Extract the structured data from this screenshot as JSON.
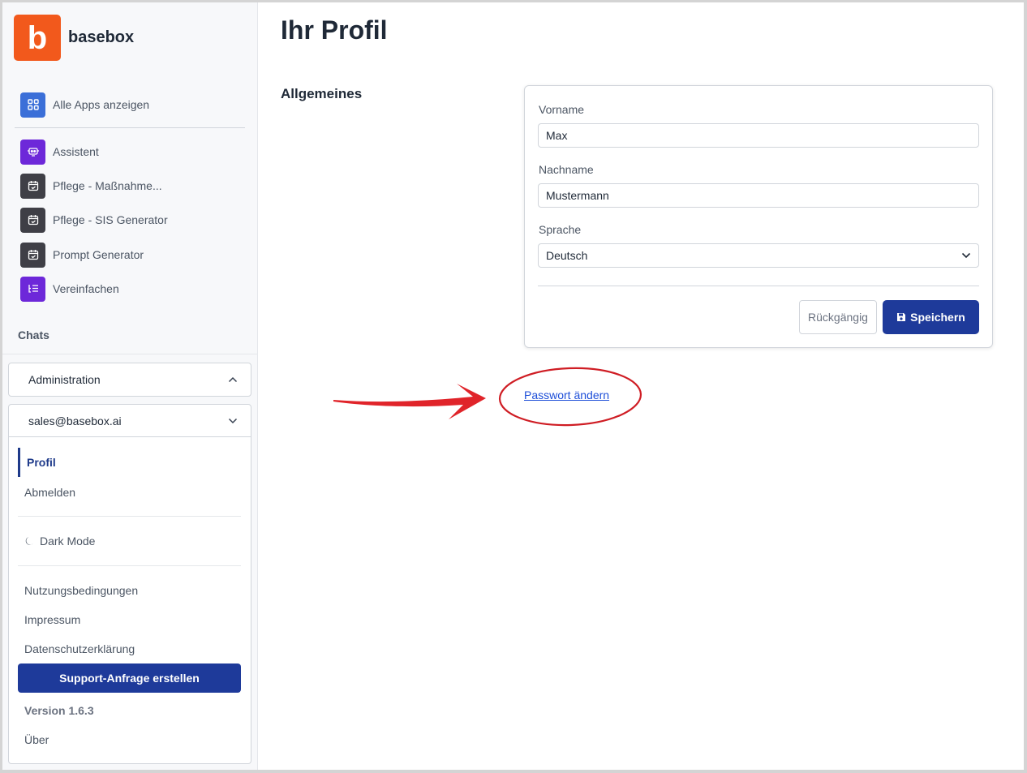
{
  "brand": {
    "name": "basebox",
    "logo_letter": "b",
    "logo_color": "#f2591c"
  },
  "sidebar": {
    "all_apps": "Alle Apps anzeigen",
    "apps": [
      {
        "label": "Assistent",
        "icon": "assistant-icon"
      },
      {
        "label": "Pflege - Maßnahme...",
        "icon": "calendar-icon"
      },
      {
        "label": "Pflege - SIS Generator",
        "icon": "calendar-icon"
      },
      {
        "label": "Prompt Generator",
        "icon": "calendar-icon"
      },
      {
        "label": "Vereinfachen",
        "icon": "list-icon"
      }
    ],
    "chats_label": "Chats",
    "administration": "Administration",
    "account_email": "sales@basebox.ai",
    "menu": {
      "profile": "Profil",
      "logout": "Abmelden",
      "dark_mode": "Dark Mode",
      "terms": "Nutzungsbedingungen",
      "imprint": "Impressum",
      "privacy": "Datenschutzerklärung",
      "support": "Support-Anfrage erstellen",
      "version": "Version 1.6.3",
      "about": "Über"
    }
  },
  "main": {
    "title": "Ihr Profil",
    "section": "Allgemeines",
    "form": {
      "first_name_label": "Vorname",
      "first_name_value": "Max",
      "last_name_label": "Nachname",
      "last_name_value": "Mustermann",
      "language_label": "Sprache",
      "language_value": "Deutsch",
      "undo_label": "Rückgängig",
      "save_label": "Speichern"
    },
    "change_password": "Passwort ändern"
  },
  "colors": {
    "primary": "#1e3a9a",
    "annotation": "#e0242a",
    "link": "#1d4ed8"
  }
}
